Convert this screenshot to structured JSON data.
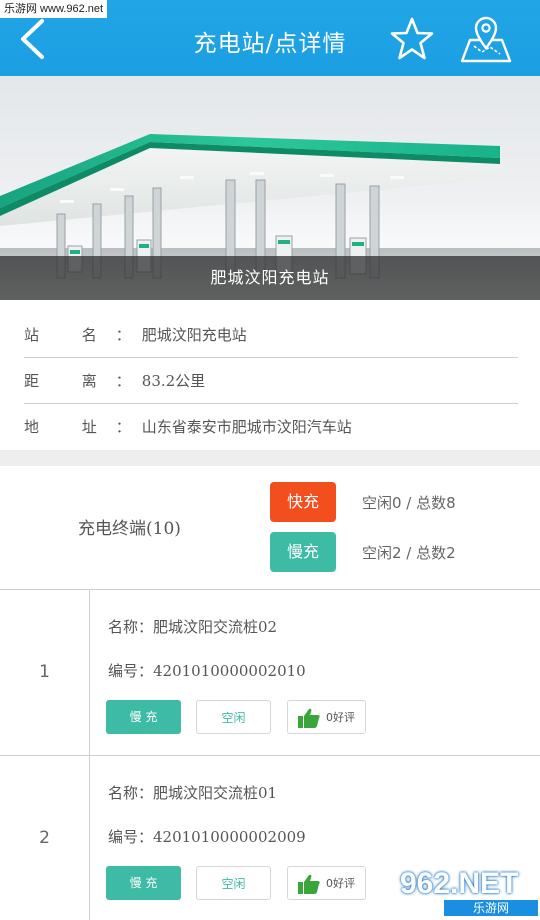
{
  "watermark": {
    "top_text": "乐游网 www.962.net",
    "logo_text": "962.NET",
    "logo_sub": "乐游网"
  },
  "header": {
    "title": "充电站/点详情",
    "back_icon": "chevron-left-icon",
    "favorite_icon": "star-outline-icon",
    "map_icon": "map-pin-icon",
    "color": "#1fa3e4"
  },
  "banner": {
    "caption": "肥城汶阳充电站"
  },
  "station_info": {
    "name_label": "站  名：",
    "name_value": "肥城汶阳充电站",
    "distance_label": "距  离：",
    "distance_value": "83.2公里",
    "address_label": "地  址：",
    "address_value": "山东省泰安市肥城市汶阳汽车站"
  },
  "terminals": {
    "title": "充电终端(10)",
    "fast": {
      "label": "快充",
      "stat": "空闲0 / 总数8",
      "color": "#f24e1e"
    },
    "slow": {
      "label": "慢充",
      "stat": "空闲2 / 总数2",
      "color": "#3dbba4"
    }
  },
  "piles": [
    {
      "index": "1",
      "name": "名称：肥城汶阳交流桩02",
      "code": "编号：4201010000002010",
      "type": "慢 充",
      "state": "空闲",
      "likes": "0好评"
    },
    {
      "index": "2",
      "name": "名称：肥城汶阳交流桩01",
      "code": "编号：4201010000002009",
      "type": "慢 充",
      "state": "空闲",
      "likes": "0好评"
    }
  ]
}
